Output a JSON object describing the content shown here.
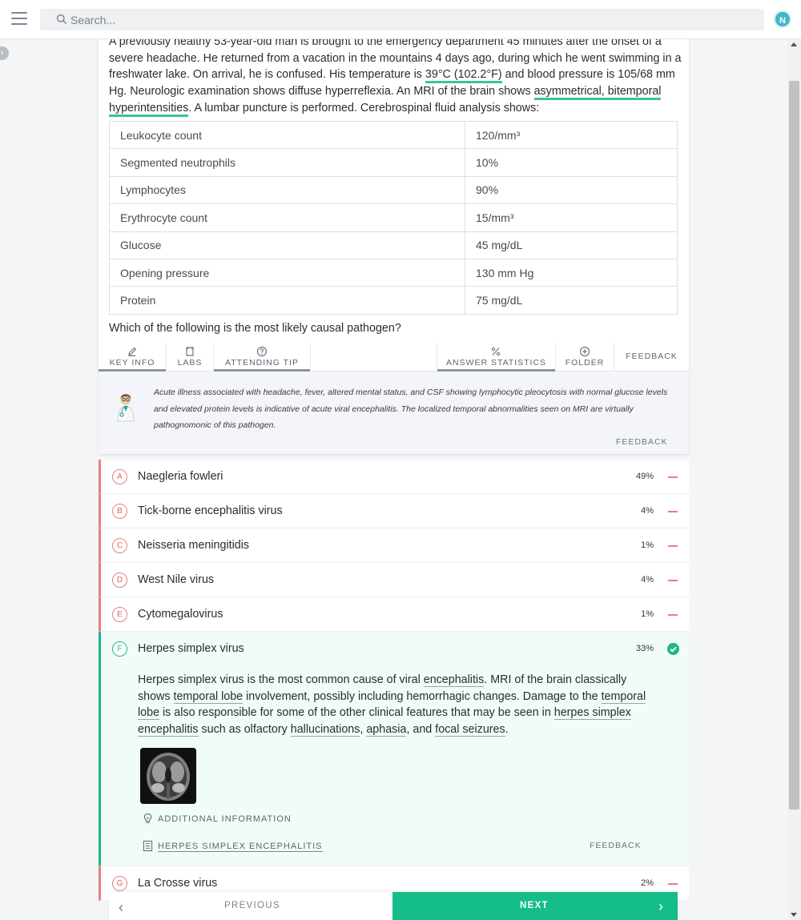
{
  "header": {
    "search_placeholder": "Search...",
    "avatar_initial": "N"
  },
  "question": {
    "stem": {
      "p1": "A previously healthy 53-year-old man is brought to the emergency department 45 minutes after the onset of a severe headache. He returned from a vacation in the mountains 4 days ago, during which he went swimming in a freshwater lake. On arrival, he is confused. His temperature is ",
      "temp": "39°C (102.2°F)",
      "p2": " and blood pressure is 105/68 mm Hg. Neurologic examination shows diffuse hyperreflexia. An MRI of the brain shows ",
      "mri_finding": "asymmetrical, bitemporal hyperintensities",
      "p3": ". A lumbar puncture is performed. Cerebrospinal fluid analysis shows:"
    },
    "labs": [
      {
        "name": "Leukocyte count",
        "value": "120/mm³"
      },
      {
        "name": "Segmented neutrophils",
        "value": "10%"
      },
      {
        "name": "Lymphocytes",
        "value": "90%"
      },
      {
        "name": "Erythrocyte count",
        "value": "15/mm³"
      },
      {
        "name": "Glucose",
        "value": "45 mg/dL"
      },
      {
        "name": "Opening pressure",
        "value": "130 mm Hg"
      },
      {
        "name": "Protein",
        "value": "75 mg/dL"
      }
    ],
    "prompt": "Which of the following is the most likely causal pathogen?"
  },
  "tabs": {
    "key_info": "KEY INFO",
    "labs": "LABS",
    "attending_tip": "ATTENDING TIP",
    "answer_statistics": "ANSWER STATISTICS",
    "folder": "FOLDER",
    "feedback": "FEEDBACK"
  },
  "attending_tip": {
    "text": "Acute illness associated with headache, fever, altered mental status, and CSF showing lymphocytic pleocytosis with normal glucose levels and elevated protein levels is indicative of acute viral encephalitis. The localized temporal abnormalities seen on MRI are virtually pathognomonic of this pathogen.",
    "feedback": "FEEDBACK"
  },
  "answers": [
    {
      "letter": "A",
      "text": "Naegleria fowleri",
      "pct": "49%"
    },
    {
      "letter": "B",
      "text": "Tick-borne encephalitis virus",
      "pct": "4%"
    },
    {
      "letter": "C",
      "text": "Neisseria meningitidis",
      "pct": "1%"
    },
    {
      "letter": "D",
      "text": "West Nile virus",
      "pct": "4%"
    },
    {
      "letter": "E",
      "text": "Cytomegalovirus",
      "pct": "1%"
    },
    {
      "letter": "F",
      "text": "Herpes simplex virus",
      "pct": "33%"
    },
    {
      "letter": "G",
      "text": "La Crosse virus",
      "pct": "2%"
    }
  ],
  "explanation": {
    "s1": "Herpes simplex virus is the most common cause of viral ",
    "l1": "encephalitis",
    "s2": ". MRI of the brain classically shows ",
    "l2": "temporal lobe",
    "s3": " involvement, possibly including hemorrhagic changes. Damage to the ",
    "l3": "temporal lobe",
    "s4": " is also responsible for some of the other clinical features that may be seen in ",
    "l4": "herpes simplex encephalitis",
    "s5": " such as olfactory ",
    "l5": "hallucinations",
    "s6": ", ",
    "l6": "aphasia",
    "s7": ", and ",
    "l7": "focal seizures",
    "s8": ".",
    "additional_info": "ADDITIONAL INFORMATION",
    "article": "HERPES SIMPLEX ENCEPHALITIS",
    "feedback": "FEEDBACK"
  },
  "navigation": {
    "previous": "PREVIOUS",
    "next": "NEXT"
  },
  "colors": {
    "accent_green": "#15bd8a",
    "correct_border": "#22b58a",
    "incorrect_border": "#e57f7f",
    "highlight": "#3ec19a"
  }
}
